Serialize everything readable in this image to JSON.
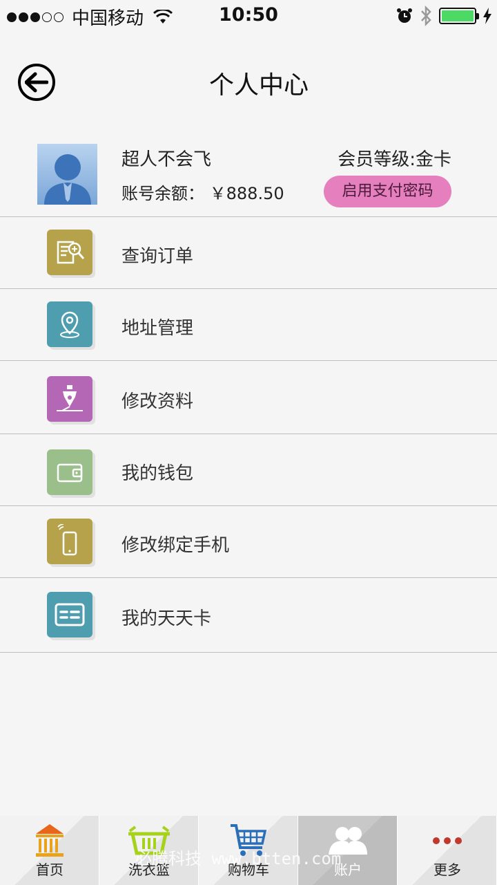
{
  "status_bar": {
    "carrier": "中国移动",
    "time": "10:50"
  },
  "header": {
    "title": "个人中心"
  },
  "profile": {
    "username": "超人不会飞",
    "balance_label": "账号余额：",
    "balance_value": "￥888.50",
    "level_label": "会员等级:",
    "level_value": "金卡",
    "pay_password_button": "启用支付密码"
  },
  "menu": [
    {
      "label": "查询订单",
      "icon": "order-search-icon",
      "color": "#b5a24a"
    },
    {
      "label": "地址管理",
      "icon": "location-pin-icon",
      "color": "#4f9eb0"
    },
    {
      "label": "修改资料",
      "icon": "pen-edit-icon",
      "color": "#b367b5"
    },
    {
      "label": "我的钱包",
      "icon": "wallet-icon",
      "color": "#9bbf8a"
    },
    {
      "label": "修改绑定手机",
      "icon": "mobile-phone-icon",
      "color": "#b5a24a"
    },
    {
      "label": "我的天天卡",
      "icon": "member-card-icon",
      "color": "#4f9eb0"
    }
  ],
  "tabbar": [
    {
      "label": "首页",
      "icon": "home-building-icon"
    },
    {
      "label": "洗衣篮",
      "icon": "laundry-basket-icon"
    },
    {
      "label": "购物车",
      "icon": "shopping-cart-icon"
    },
    {
      "label": "账户",
      "icon": "users-icon",
      "active": true
    },
    {
      "label": "更多",
      "icon": "more-dots-icon"
    }
  ],
  "watermark": "必腾科技 www.btten.com"
}
